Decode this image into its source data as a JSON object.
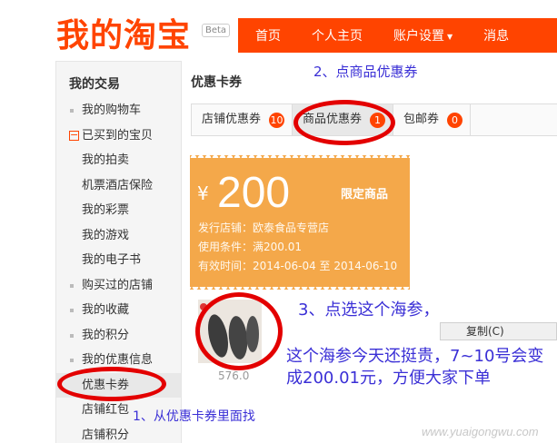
{
  "header": {
    "logo": "我的淘宝",
    "beta": "Beta",
    "nav": [
      "首页",
      "个人主页",
      "账户设置",
      "消息"
    ]
  },
  "sidebar": {
    "title": "我的交易",
    "items": [
      {
        "label": "我的购物车",
        "type": "bullet"
      },
      {
        "label": "已买到的宝贝",
        "type": "collapse"
      },
      {
        "label": "我的拍卖",
        "type": "plain"
      },
      {
        "label": "机票酒店保险",
        "type": "plain"
      },
      {
        "label": "我的彩票",
        "type": "plain"
      },
      {
        "label": "我的游戏",
        "type": "plain"
      },
      {
        "label": "我的电子书",
        "type": "plain"
      },
      {
        "label": "购买过的店铺",
        "type": "bullet"
      },
      {
        "label": "我的收藏",
        "type": "bullet"
      },
      {
        "label": "我的积分",
        "type": "bullet"
      },
      {
        "label": "我的优惠信息",
        "type": "bullet"
      },
      {
        "label": "优惠卡券",
        "type": "active"
      },
      {
        "label": "店铺红包",
        "type": "plain"
      },
      {
        "label": "店铺积分",
        "type": "plain"
      }
    ]
  },
  "main": {
    "title": "优惠卡券",
    "tabs": [
      {
        "label": "店铺优惠券",
        "count": "10"
      },
      {
        "label": "商品优惠券",
        "count": "1"
      },
      {
        "label": "包邮券",
        "count": "0"
      }
    ]
  },
  "coupon": {
    "currency": "¥",
    "amount": "200",
    "limit": "限定商品",
    "shop": "发行店铺：欧泰食品专营店",
    "condition": "使用条件：满200.01",
    "validity": "有效时间：2014-06-04 至 2014-06-10"
  },
  "product": {
    "price": "576.0"
  },
  "context_menu": {
    "copy": "复制(C)"
  },
  "annotations": {
    "step1": "1、从优惠卡券里面找",
    "step2": "2、点商品优惠券",
    "step3": "3、点选这个海参，",
    "note": "这个海参今天还挺贵，7~10号会变成200.01元，方便大家下单"
  },
  "watermark": "www.yuaigongwu.com",
  "colors": {
    "brand": "#ff4400",
    "coupon": "#f4a84a",
    "annotation": "#3a2fd6",
    "highlight": "#e30000"
  }
}
